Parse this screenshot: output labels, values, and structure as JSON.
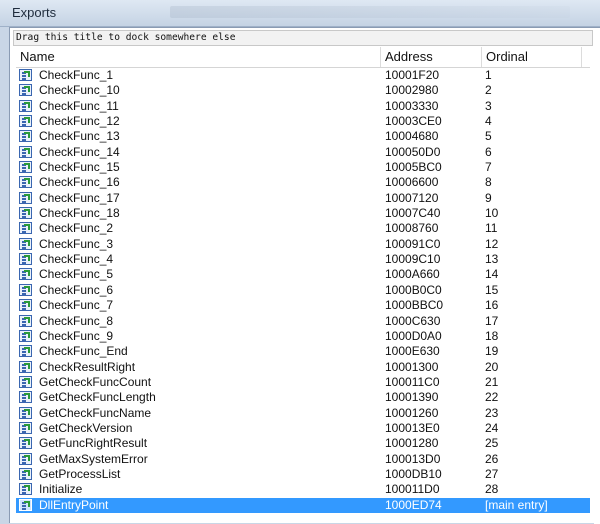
{
  "window": {
    "title": "Exports"
  },
  "dock_hint": "Drag this title to dock somewhere else",
  "columns": {
    "name": "Name",
    "address": "Address",
    "ordinal": "Ordinal"
  },
  "rows": [
    {
      "name": "CheckFunc_1",
      "address": "10001F20",
      "ordinal": "1"
    },
    {
      "name": "CheckFunc_10",
      "address": "10002980",
      "ordinal": "2"
    },
    {
      "name": "CheckFunc_11",
      "address": "10003330",
      "ordinal": "3"
    },
    {
      "name": "CheckFunc_12",
      "address": "10003CE0",
      "ordinal": "4"
    },
    {
      "name": "CheckFunc_13",
      "address": "10004680",
      "ordinal": "5"
    },
    {
      "name": "CheckFunc_14",
      "address": "100050D0",
      "ordinal": "6"
    },
    {
      "name": "CheckFunc_15",
      "address": "10005BC0",
      "ordinal": "7"
    },
    {
      "name": "CheckFunc_16",
      "address": "10006600",
      "ordinal": "8"
    },
    {
      "name": "CheckFunc_17",
      "address": "10007120",
      "ordinal": "9"
    },
    {
      "name": "CheckFunc_18",
      "address": "10007C40",
      "ordinal": "10"
    },
    {
      "name": "CheckFunc_2",
      "address": "10008760",
      "ordinal": "11"
    },
    {
      "name": "CheckFunc_3",
      "address": "100091C0",
      "ordinal": "12"
    },
    {
      "name": "CheckFunc_4",
      "address": "10009C10",
      "ordinal": "13"
    },
    {
      "name": "CheckFunc_5",
      "address": "1000A660",
      "ordinal": "14"
    },
    {
      "name": "CheckFunc_6",
      "address": "1000B0C0",
      "ordinal": "15"
    },
    {
      "name": "CheckFunc_7",
      "address": "1000BBC0",
      "ordinal": "16"
    },
    {
      "name": "CheckFunc_8",
      "address": "1000C630",
      "ordinal": "17"
    },
    {
      "name": "CheckFunc_9",
      "address": "1000D0A0",
      "ordinal": "18"
    },
    {
      "name": "CheckFunc_End",
      "address": "1000E630",
      "ordinal": "19"
    },
    {
      "name": "CheckResultRight",
      "address": "10001300",
      "ordinal": "20"
    },
    {
      "name": "GetCheckFuncCount",
      "address": "100011C0",
      "ordinal": "21"
    },
    {
      "name": "GetCheckFuncLength",
      "address": "10001390",
      "ordinal": "22"
    },
    {
      "name": "GetCheckFuncName",
      "address": "10001260",
      "ordinal": "23"
    },
    {
      "name": "GetCheckVersion",
      "address": "100013E0",
      "ordinal": "24"
    },
    {
      "name": "GetFuncRightResult",
      "address": "10001280",
      "ordinal": "25"
    },
    {
      "name": "GetMaxSystemError",
      "address": "100013D0",
      "ordinal": "26"
    },
    {
      "name": "GetProcessList",
      "address": "1000DB10",
      "ordinal": "27"
    },
    {
      "name": "Initialize",
      "address": "100011D0",
      "ordinal": "28"
    },
    {
      "name": "DllEntryPoint",
      "address": "1000ED74",
      "ordinal": "[main entry]",
      "selected": true
    }
  ],
  "icon": "export-function-icon",
  "colors": {
    "selection": "#3399ff",
    "frame": "#c9d6e6"
  }
}
